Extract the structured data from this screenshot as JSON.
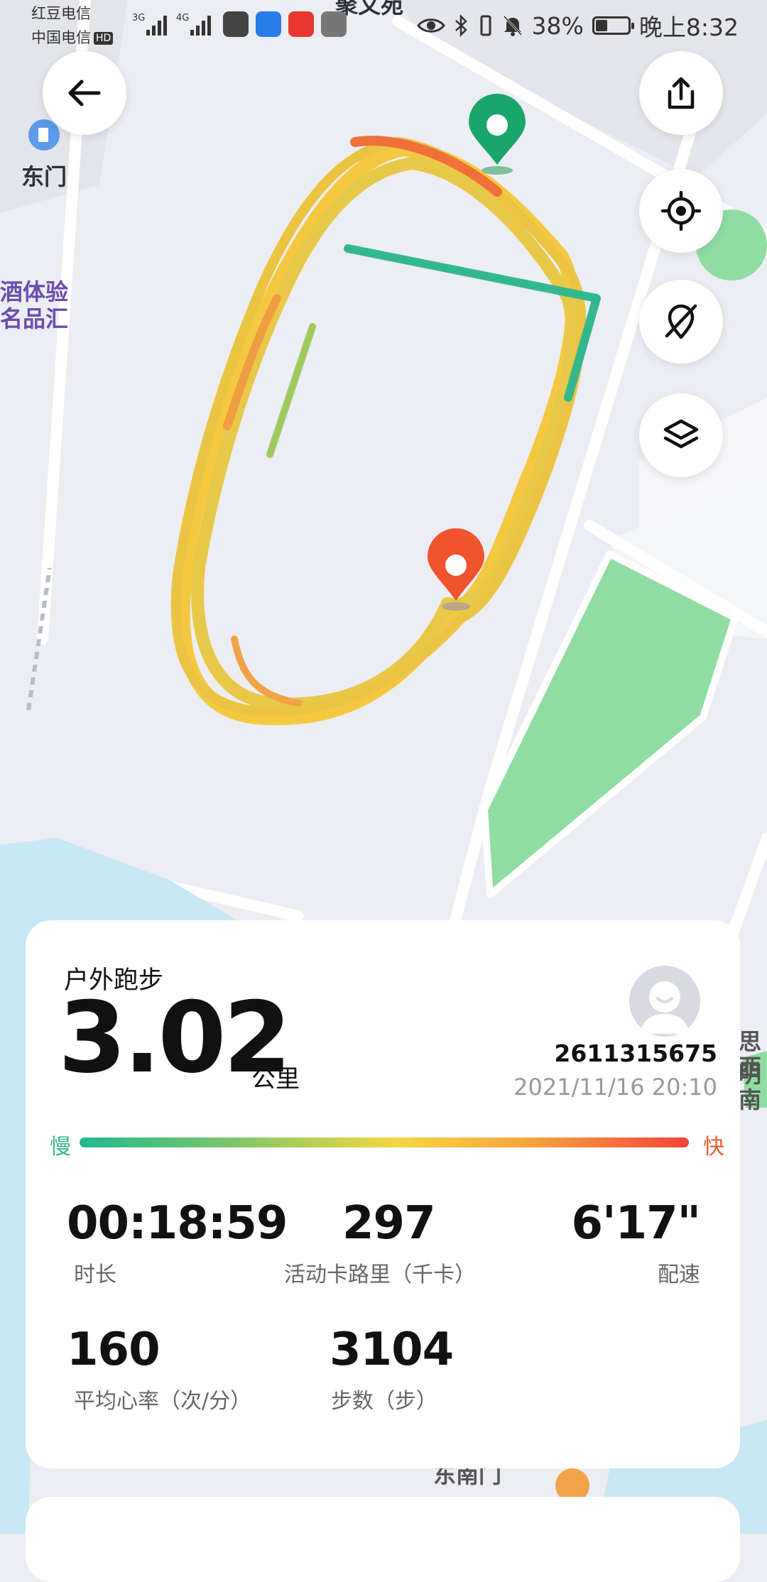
{
  "status_bar": {
    "carrier_1": "红豆电信",
    "carrier_2": "中国电信",
    "carrier_2_badge": "HD",
    "signal_1_type": "3G",
    "signal_2_type": "4G",
    "battery_percent": "38%",
    "time": "晚上8:32",
    "icons": [
      "eye-icon",
      "bluetooth-icon",
      "vibrate-icon",
      "mute-icon",
      "battery-icon"
    ]
  },
  "map": {
    "labels": {
      "east_gate": "东门",
      "top_partial": "聚文苑",
      "left_partial_1": "酒体验",
      "left_partial_2": "名品汇",
      "bottom_partial": "东南门",
      "right_partial_1": "思明",
      "right_partial_2": "西南"
    },
    "colors": {
      "start_marker": "#1aa56a",
      "end_marker": "#f0532e",
      "park": "#8fdda3"
    }
  },
  "buttons": {
    "back": "arrow-left-icon",
    "share": "share-icon",
    "locate": "locate-icon",
    "hide_track": "hide-track-icon",
    "layers": "layers-icon"
  },
  "workout": {
    "type": "户外跑步",
    "distance": "3.02",
    "distance_unit": "公里",
    "user_id": "2611315675",
    "datetime": "2021/11/16 20:10",
    "pace_legend": {
      "slow": "慢",
      "fast": "快"
    },
    "stats": [
      {
        "value": "00:18:59",
        "label": "时长"
      },
      {
        "value": "297",
        "label": "活动卡路里（千卡）"
      },
      {
        "value": "6'17\"",
        "label": "配速"
      },
      {
        "value": "160",
        "label": "平均心率（次/分）"
      },
      {
        "value": "3104",
        "label": "步数（步）"
      }
    ]
  }
}
